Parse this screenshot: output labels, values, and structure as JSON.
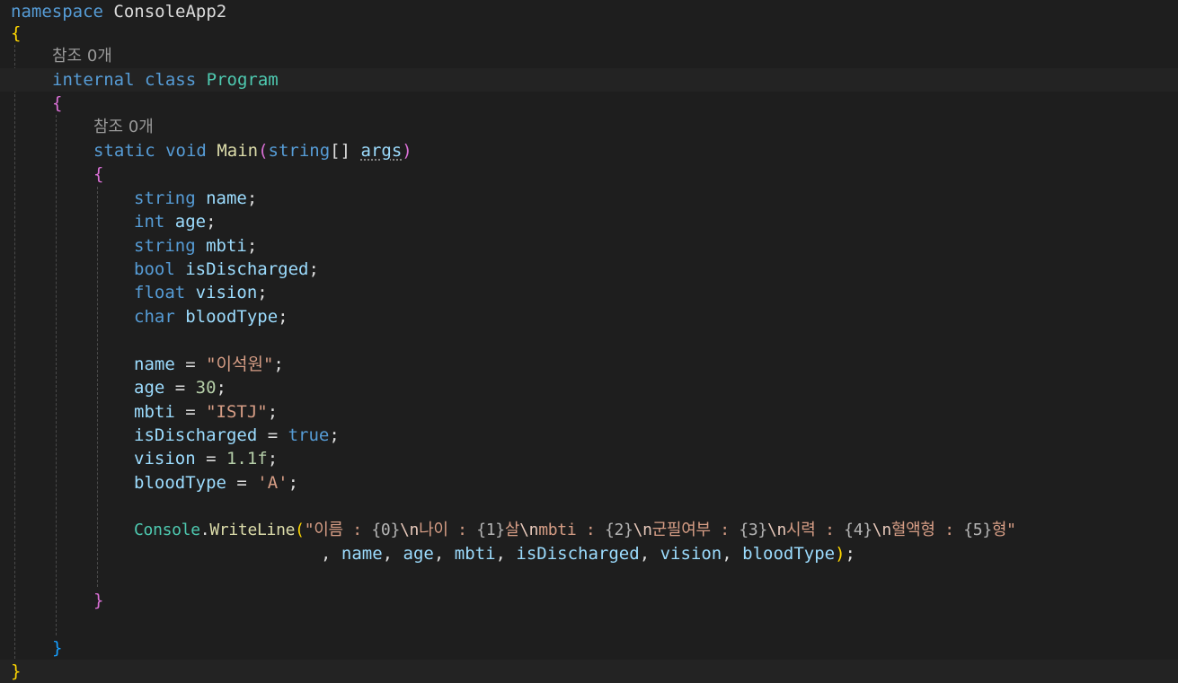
{
  "colors": {
    "background": "#1e1e1e",
    "keyword": "#569cd6",
    "type_name": "#4ec9b0",
    "method": "#dcdcaa",
    "identifier": "#9cdcfe",
    "string": "#d69d85",
    "number": "#b5cea8",
    "brace_level1": "#ffd700",
    "brace_level2": "#da70d6",
    "brace_level3": "#179fff",
    "codelens": "#999999"
  },
  "code": {
    "kw_namespace": "namespace",
    "ns_name": "ConsoleApp2",
    "brace_open": "{",
    "brace_close": "}",
    "codelens_refs": "참조 0개",
    "kw_internal": "internal",
    "kw_class": "class",
    "class_name": "Program",
    "kw_static": "static",
    "kw_void": "void",
    "method_main": "Main",
    "paren_open": "(",
    "paren_close": ")",
    "kw_string": "string",
    "array_brackets": "[]",
    "param_args": "args",
    "kw_int": "int",
    "kw_bool": "bool",
    "kw_float": "float",
    "kw_char": "char",
    "kw_true": "true",
    "var_name": "name",
    "var_age": "age",
    "var_mbti": "mbti",
    "var_isDischarged": "isDischarged",
    "var_vision": "vision",
    "var_bloodType": "bloodType",
    "semicolon": ";",
    "assign": " = ",
    "comma": ", ",
    "lit_name": "\"이석원\"",
    "lit_age": "30",
    "lit_mbti": "\"ISTJ\"",
    "lit_vision": "1.1f",
    "lit_blood": "'A'",
    "console_class": "Console",
    "dot": ".",
    "method_writeline": "WriteLine",
    "fmt_quote": "\"",
    "fmt_label_name": "이름 : ",
    "fmt_ph0": "{0}",
    "fmt_esc": "\\n",
    "fmt_label_age": "나이 : ",
    "fmt_ph1": "{1}",
    "fmt_label_mbti": "살",
    "fmt_mbti": "mbti : ",
    "fmt_ph2": "{2}",
    "fmt_label_discharged": "군필여부 : ",
    "fmt_ph3": "{3}",
    "fmt_label_vision": "시력 : ",
    "fmt_ph4": "{4}",
    "fmt_label_blood": "혈액형 : ",
    "fmt_ph5": "{5}",
    "fmt_tail": "형\"",
    "cont_prefix": ", "
  }
}
